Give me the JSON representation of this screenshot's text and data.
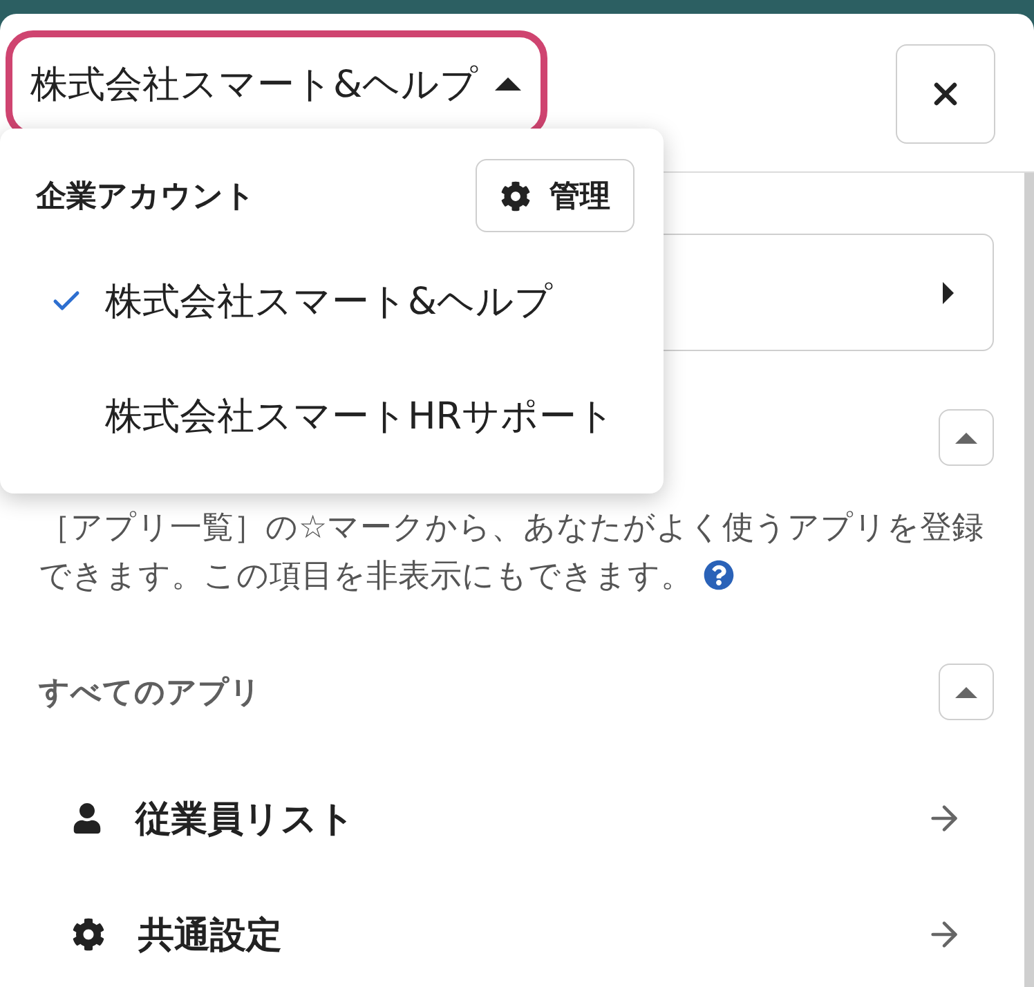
{
  "account_selector": {
    "label": "株式会社スマート&ヘルプ",
    "expanded": true
  },
  "account_menu": {
    "title": "企業アカウント",
    "manage_button": {
      "label": "管理"
    },
    "items": [
      {
        "label": "株式会社スマート&ヘルプ",
        "selected": true
      },
      {
        "label": "株式会社スマートHRサポート",
        "selected": false
      }
    ]
  },
  "favorites": {
    "expanded": true,
    "description": "［アプリ一覧］の☆マークから、あなたがよく使うアプリを登録できます。この項目を非表示にもできます。"
  },
  "all_apps": {
    "title": "すべてのアプリ",
    "expanded": true,
    "items": [
      {
        "label": "従業員リスト"
      },
      {
        "label": "共通設定"
      }
    ]
  }
}
